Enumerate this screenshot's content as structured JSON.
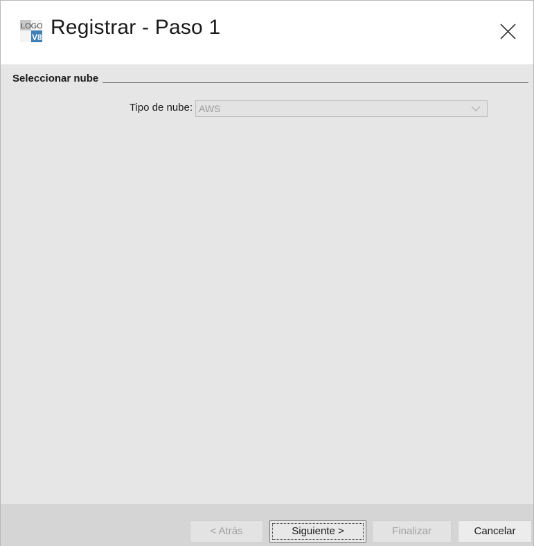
{
  "window": {
    "title": "Registrar - Paso 1",
    "app_icon": "logo-v8-app-icon",
    "close_icon": "close-icon",
    "close_symbol": "×"
  },
  "section": {
    "title": "Seleccionar nube"
  },
  "form": {
    "cloud_type_label": "Tipo de nube:",
    "cloud_type_value": "AWS",
    "cloud_type_icon": "chevron-down-icon"
  },
  "footer": {
    "back_label": "< Atrás",
    "next_label": "Siguiente >",
    "finish_label": "Finalizar",
    "cancel_label": "Cancelar"
  },
  "colors": {
    "content_bg": "#e6e6e6",
    "footer_bg": "#d5d5d5",
    "disabled_text": "#a0a0a0",
    "logo_blue": "#3f7fb3"
  }
}
